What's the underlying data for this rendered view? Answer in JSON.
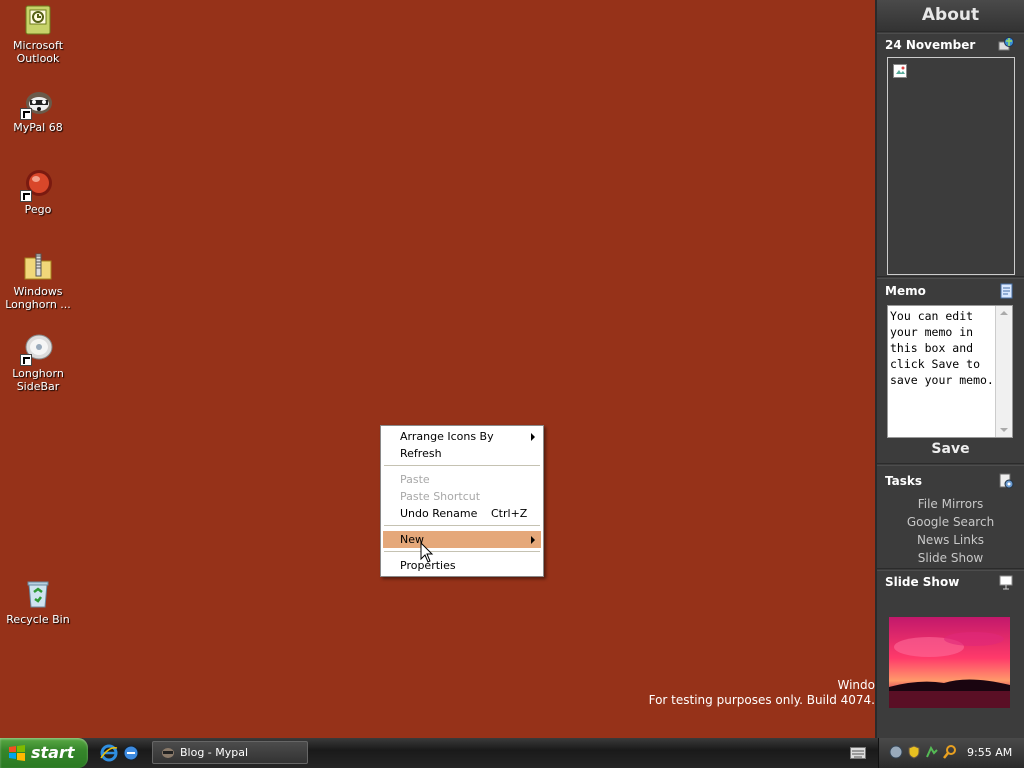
{
  "desktop": {
    "icons": [
      {
        "label_1": "Microsoft",
        "label_2": "Outlook"
      },
      {
        "label_1": "MyPal 68",
        "label_2": ""
      },
      {
        "label_1": "Pego",
        "label_2": ""
      },
      {
        "label_1": "Windows",
        "label_2": "Longhorn ..."
      },
      {
        "label_1": "Longhorn",
        "label_2": "SideBar"
      },
      {
        "label_1": "Recycle Bin",
        "label_2": ""
      }
    ],
    "watermark_line1": "Windo",
    "watermark_line2": "For testing purposes only. Build 4074."
  },
  "context_menu": {
    "items": [
      {
        "label": "Arrange Icons By"
      },
      {
        "label": "Refresh"
      },
      {
        "label": "Paste"
      },
      {
        "label": "Paste Shortcut"
      },
      {
        "label": "Undo Rename",
        "shortcut": "Ctrl+Z"
      },
      {
        "label": "New"
      },
      {
        "label": "Properties"
      }
    ]
  },
  "sidebar": {
    "header": "About",
    "date_title": "24 November",
    "memo": {
      "title": "Memo",
      "text": "You can edit your memo in this box and click Save to save your memo.",
      "save_label": "Save"
    },
    "tasks": {
      "title": "Tasks",
      "links": [
        "File Mirrors",
        "Google Search",
        "News Links",
        "Slide Show"
      ]
    },
    "slideshow": {
      "title": "Slide Show"
    }
  },
  "taskbar": {
    "start_label": "start",
    "window_button": "Blog - Mypal",
    "clock": "9:55 AM"
  },
  "colors": {
    "desktop_bg": "#963219",
    "sidebar_bg": "#3c3c3c",
    "menu_highlight": "#e5a87a"
  }
}
